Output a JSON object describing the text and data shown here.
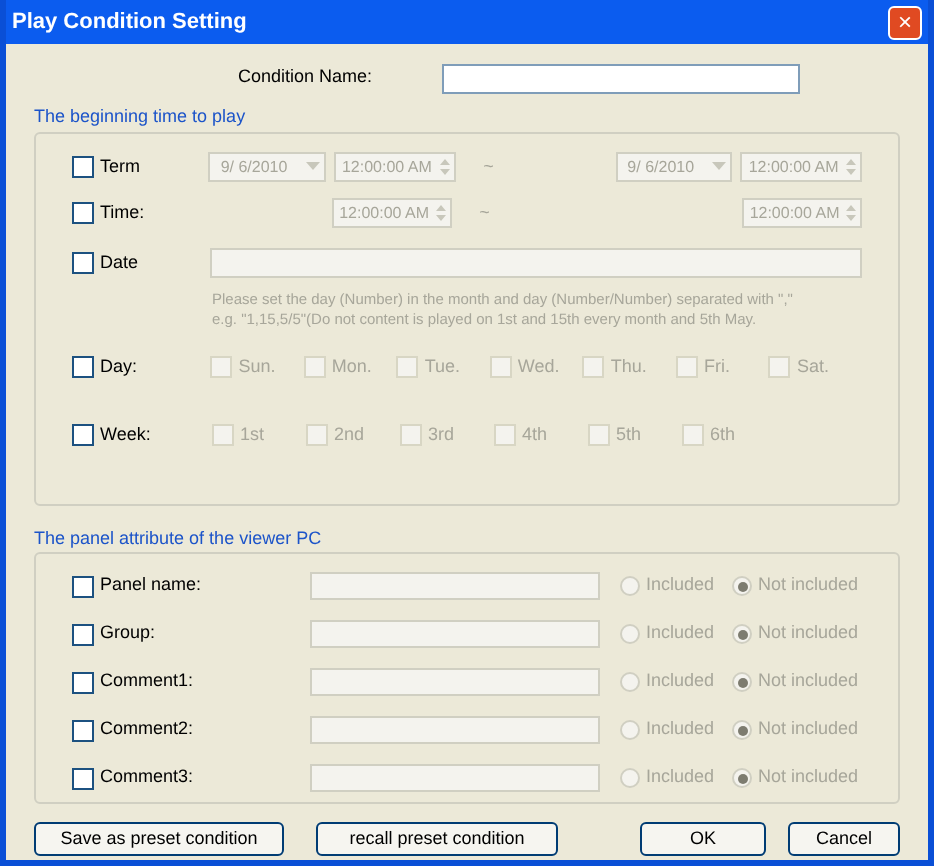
{
  "window": {
    "title": "Play Condition Setting",
    "close": "×"
  },
  "condition_name": {
    "label": "Condition Name:"
  },
  "beginning": {
    "title": "The beginning time to play",
    "term": {
      "label": "Term",
      "checked": false,
      "from_date": "9/ 6/2010",
      "from_time": "12:00:00 AM",
      "separator": "~",
      "to_date": "9/ 6/2010",
      "to_time": "12:00:00 AM"
    },
    "time": {
      "label": "Time:",
      "checked": false,
      "from_time": "12:00:00 AM",
      "separator": "~",
      "to_time": "12:00:00 AM"
    },
    "date": {
      "label": "Date",
      "checked": false,
      "hint": [
        "Please set the day (Number) in the month and day (Number/Number) separated with \",\"",
        "e.g. \"1,15,5/5\"(Do not content is played on 1st and 15th every month and 5th May."
      ]
    },
    "day": {
      "label": "Day:",
      "checked": false,
      "options": [
        {
          "label": "Sun.",
          "checked": false
        },
        {
          "label": "Mon.",
          "checked": false
        },
        {
          "label": "Tue.",
          "checked": false
        },
        {
          "label": "Wed.",
          "checked": false
        },
        {
          "label": "Thu.",
          "checked": false
        },
        {
          "label": "Fri.",
          "checked": false
        },
        {
          "label": "Sat.",
          "checked": false
        }
      ]
    },
    "week": {
      "label": "Week:",
      "checked": false,
      "options": [
        {
          "label": "1st",
          "checked": false
        },
        {
          "label": "2nd",
          "checked": false
        },
        {
          "label": "3rd",
          "checked": false
        },
        {
          "label": "4th",
          "checked": false
        },
        {
          "label": "5th",
          "checked": false
        },
        {
          "label": "6th",
          "checked": false
        }
      ]
    }
  },
  "panel": {
    "title": "The panel attribute of the viewer PC",
    "rows": [
      {
        "label": "Panel name:",
        "checked": false,
        "options": [
          {
            "label": "Included",
            "selected": false
          },
          {
            "label": "Not included",
            "selected": true
          }
        ]
      },
      {
        "label": "Group:",
        "checked": false,
        "options": [
          {
            "label": "Included",
            "selected": false
          },
          {
            "label": "Not included",
            "selected": true
          }
        ]
      },
      {
        "label": "Comment1:",
        "checked": false,
        "options": [
          {
            "label": "Included",
            "selected": false
          },
          {
            "label": "Not included",
            "selected": true
          }
        ]
      },
      {
        "label": "Comment2:",
        "checked": false,
        "options": [
          {
            "label": "Included",
            "selected": false
          },
          {
            "label": "Not included",
            "selected": true
          }
        ]
      },
      {
        "label": "Comment3:",
        "checked": false,
        "options": [
          {
            "label": "Included",
            "selected": false
          },
          {
            "label": "Not included",
            "selected": true
          }
        ]
      }
    ]
  },
  "buttons": {
    "save": "Save as preset condition",
    "recall": "recall preset condition",
    "ok": "OK",
    "cancel": "Cancel"
  }
}
